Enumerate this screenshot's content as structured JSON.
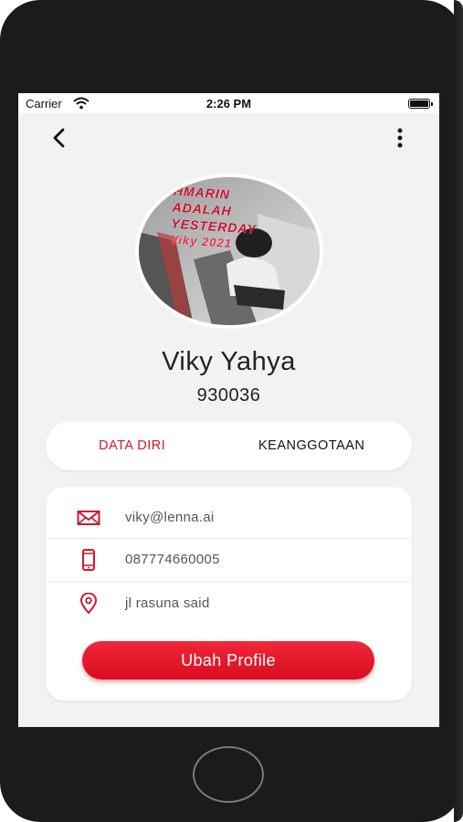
{
  "status_bar": {
    "carrier": "Carrier",
    "time": "2:26 PM"
  },
  "header": {
    "back_icon": "chevron-left-icon",
    "more_icon": "vertical-dots-icon"
  },
  "profile": {
    "avatar_caption_lines": [
      "HMARIN",
      "ADALAH",
      "YESTERDAY"
    ],
    "avatar_caption_sub": "Viky 2021",
    "name": "Viky Yahya",
    "member_id": "930036"
  },
  "tabs": [
    {
      "label": "DATA DIRI",
      "active": true
    },
    {
      "label": "KEANGGOTAAN",
      "active": false
    }
  ],
  "details": {
    "email": "viky@lenna.ai",
    "phone": "087774660005",
    "address": "jl rasuna said"
  },
  "actions": {
    "edit_profile_label": "Ubah Profile"
  },
  "colors": {
    "accent": "#d0172f",
    "button": "#e81a2c",
    "background": "#f2f2f2"
  }
}
